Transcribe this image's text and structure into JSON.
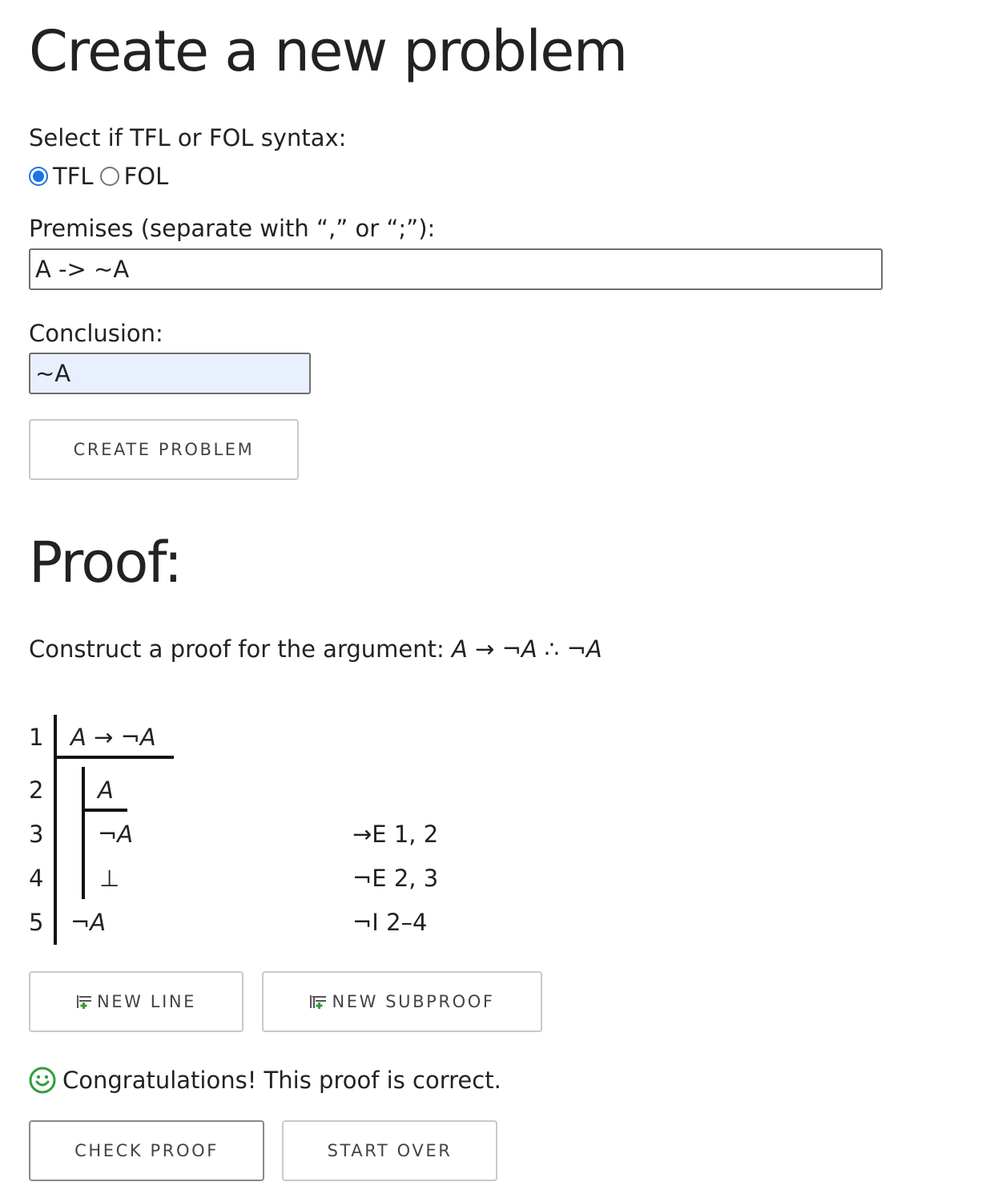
{
  "page": {
    "title": "Create a new problem"
  },
  "syntax": {
    "label": "Select if TFL or FOL syntax:",
    "options": [
      {
        "label": "TFL",
        "selected": true
      },
      {
        "label": "FOL",
        "selected": false
      }
    ]
  },
  "premises": {
    "label": "Premises (separate with “,” or “;”):",
    "value": "A -> ~A"
  },
  "conclusion": {
    "label": "Conclusion:",
    "value": "~A"
  },
  "create_button": "CREATE PROBLEM",
  "proof": {
    "title": "Proof:",
    "instruction_prefix": "Construct a proof for the argument: ",
    "argument": "A → ¬A ∴ ¬A",
    "lines": [
      {
        "num": "1",
        "formula": "A → ¬A",
        "justification": ""
      },
      {
        "num": "2",
        "formula": "A",
        "justification": ""
      },
      {
        "num": "3",
        "formula": "¬A",
        "justification": "→E 1, 2"
      },
      {
        "num": "4",
        "formula": "⊥",
        "justification": "¬E 2, 3"
      },
      {
        "num": "5",
        "formula": "¬A",
        "justification": "¬I 2–4"
      }
    ]
  },
  "buttons": {
    "new_line": "NEW LINE",
    "new_subproof": "NEW SUBPROOF",
    "check_proof": "CHECK PROOF",
    "start_over": "START OVER"
  },
  "status": {
    "message": "Congratulations! This proof is correct.",
    "icon": "smiley-icon",
    "color": "#2e9e3e"
  },
  "colors": {
    "radio_accent": "#1a73e8",
    "autofill_bg": "#e8f0fe",
    "icon_green": "#3a9a3a"
  }
}
